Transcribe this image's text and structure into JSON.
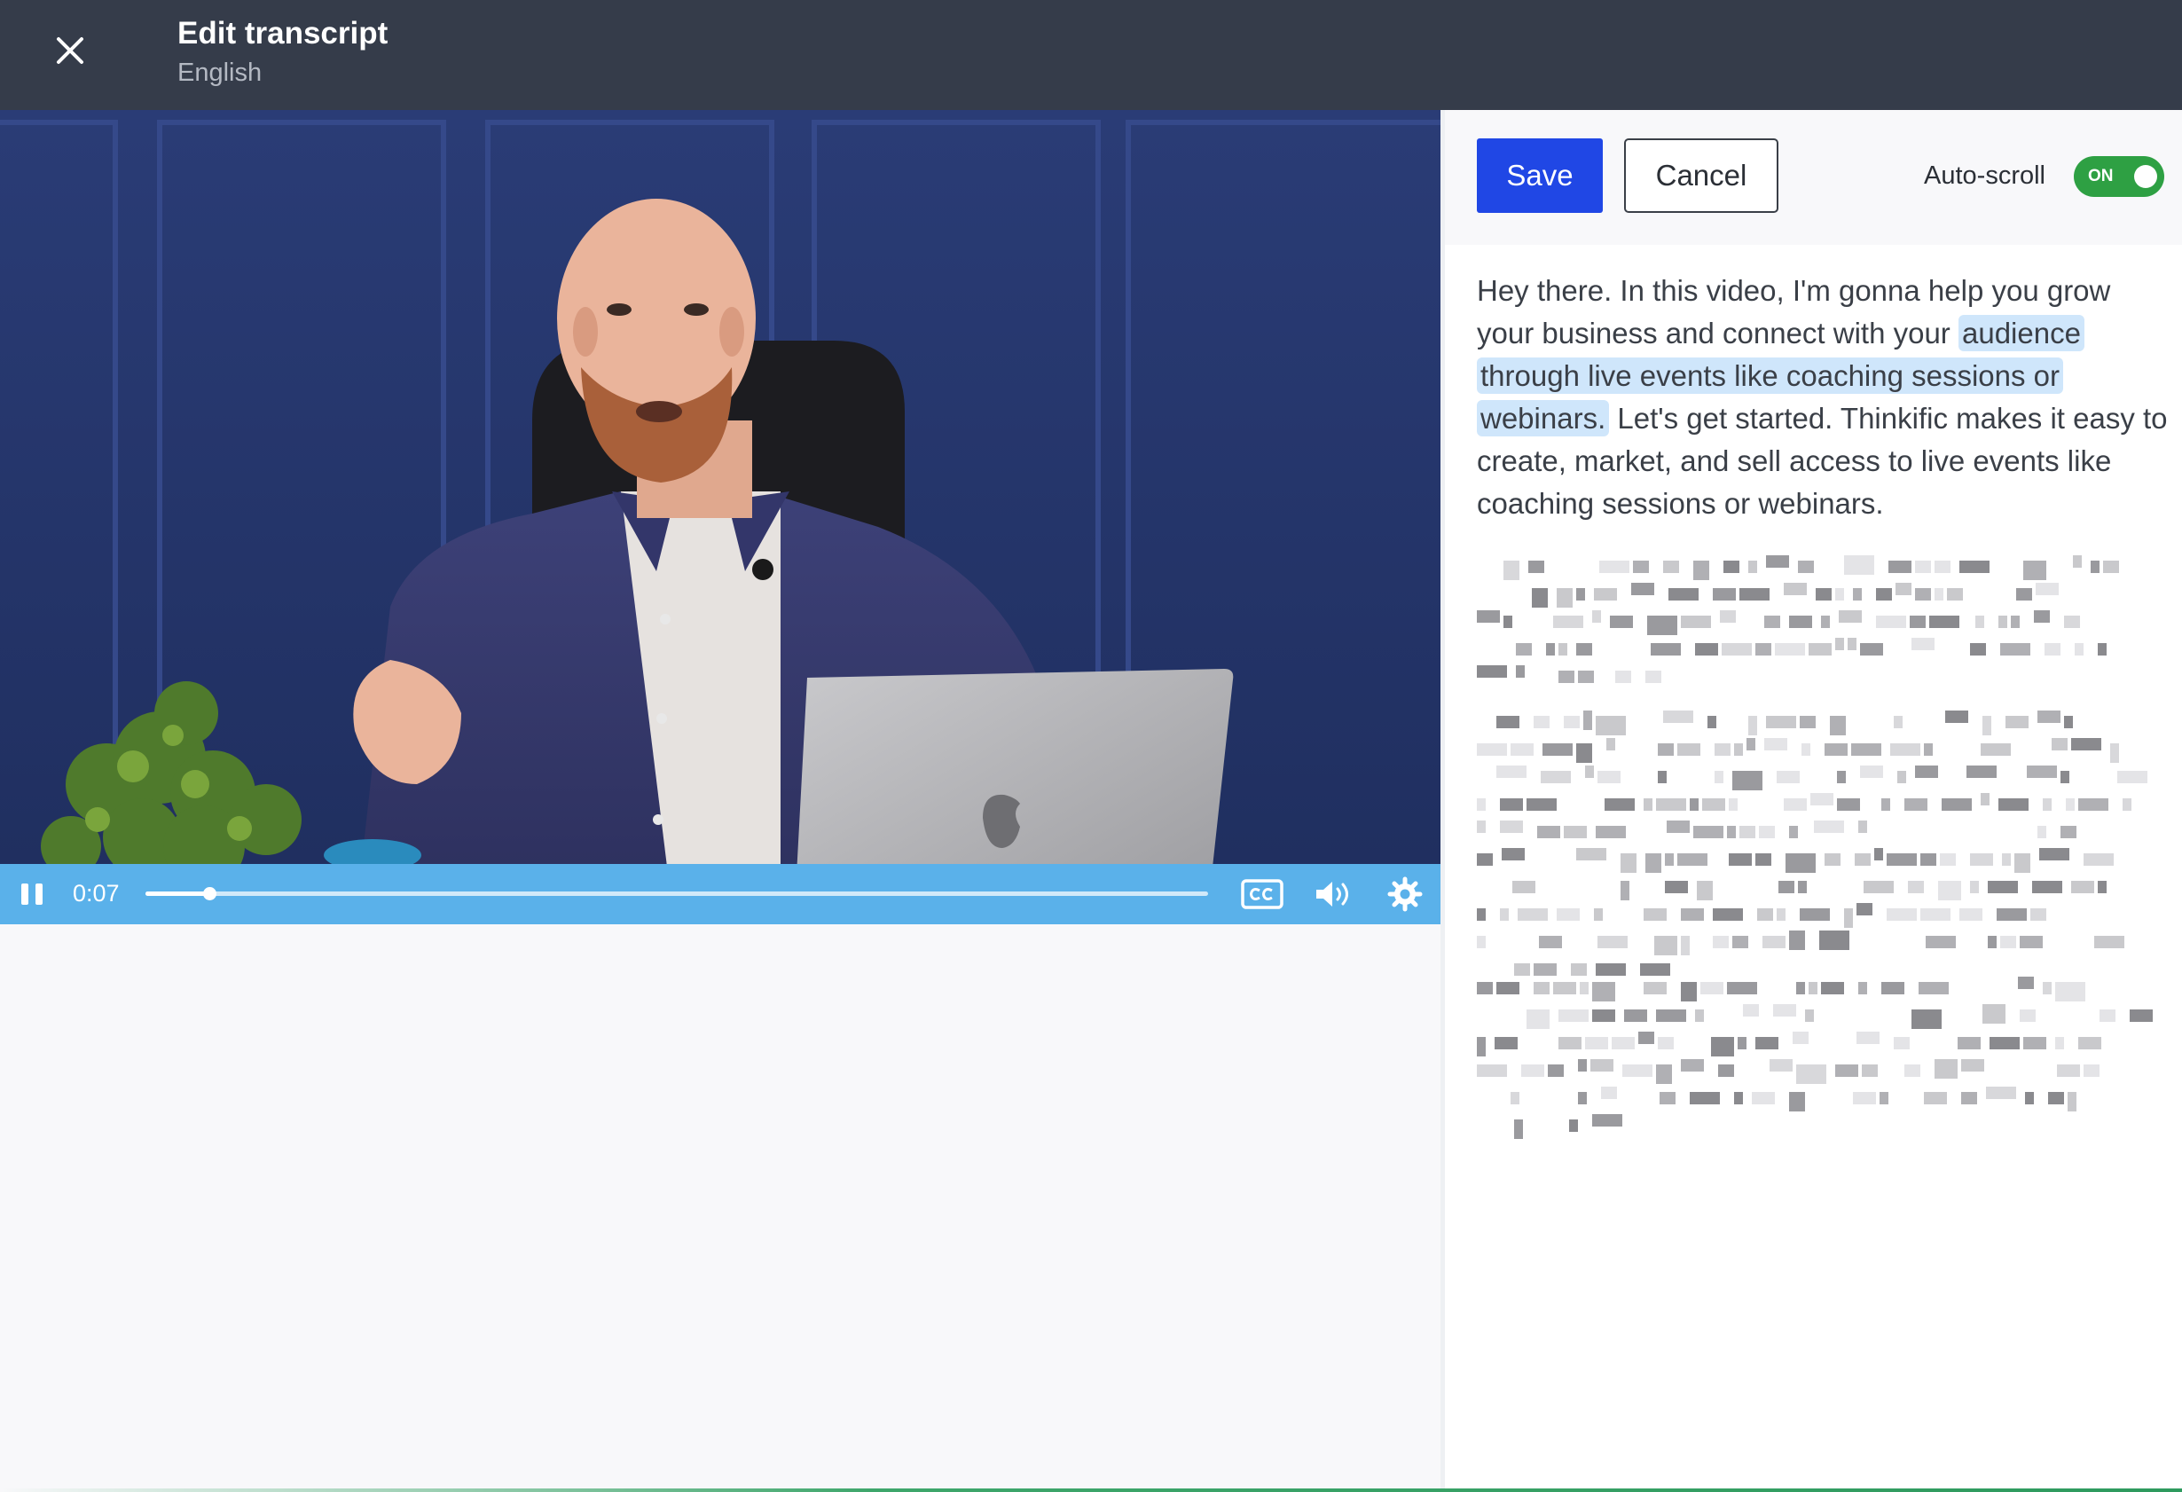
{
  "header": {
    "title": "Edit transcript",
    "language": "English",
    "close_icon": "close-icon"
  },
  "player": {
    "current_time": "0:07",
    "progress_fraction": 0.06,
    "controls": [
      "pause-icon",
      "closed-captions-icon",
      "volume-icon",
      "settings-gear-icon"
    ],
    "scene": "presenter at desk with laptop and plant"
  },
  "toolbar": {
    "save_label": "Save",
    "cancel_label": "Cancel",
    "autoscroll_label": "Auto-scroll",
    "autoscroll_state": "ON"
  },
  "transcript": {
    "before": "Hey there. In this video, I'm gonna help you grow your business and connect with your ",
    "highlighted": "audience through live events like coaching sessions or webinars.",
    "after": " Let's get started. Thinkific makes it easy to create, market, and sell access to live events like coaching sessions or webinars."
  },
  "colors": {
    "header_bg": "#353c4a",
    "save_button": "#2047e5",
    "toggle_on": "#2ea043",
    "player_bar": "#5ab1ea",
    "highlight": "#cfe6fb"
  }
}
